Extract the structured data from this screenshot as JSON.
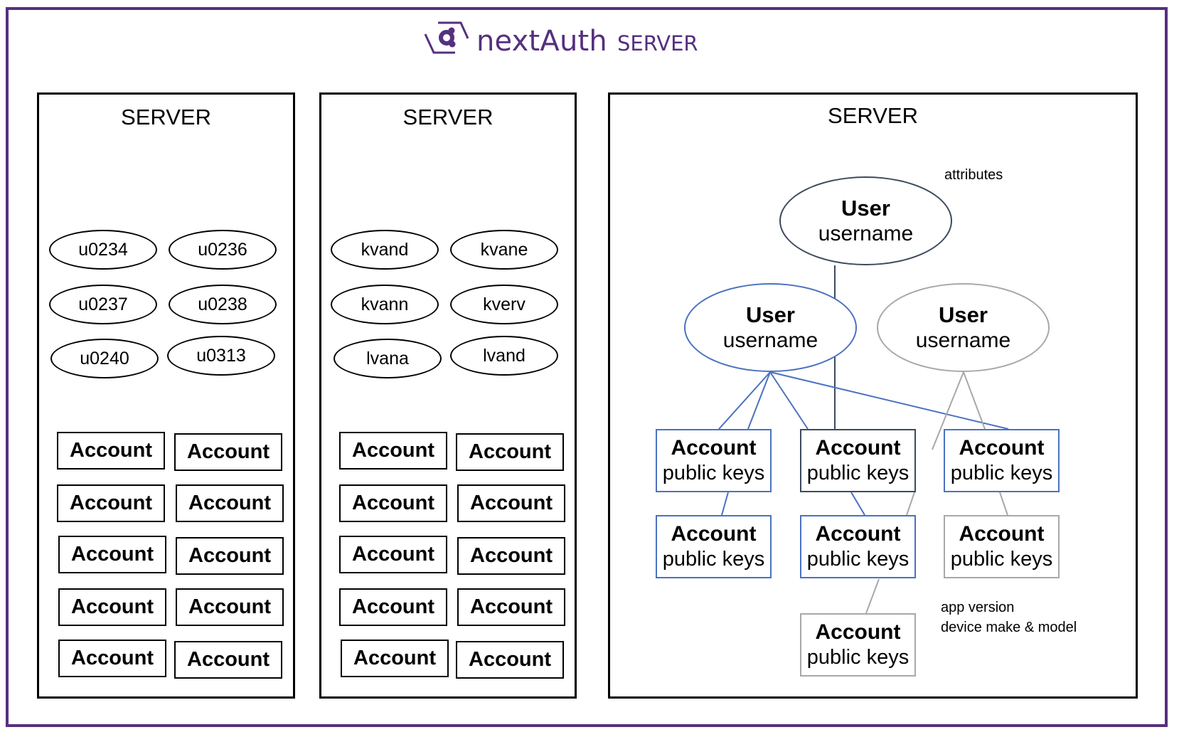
{
  "brand": {
    "name": "nextAuth",
    "suffix": "SERVER",
    "logo_icon": "nextauth-logo-icon",
    "color": "#55307f"
  },
  "colors": {
    "frame": "#55307f",
    "blue": "#4a72c0",
    "slate": "#3d4a5e",
    "gray": "#a8a8a8"
  },
  "panels": [
    {
      "title": "SERVER",
      "ovals": [
        "u0234",
        "u0236",
        "u0237",
        "u0238",
        "u0240",
        "u0313"
      ],
      "accounts": [
        "Account",
        "Account",
        "Account",
        "Account",
        "Account",
        "Account",
        "Account",
        "Account",
        "Account",
        "Account"
      ]
    },
    {
      "title": "SERVER",
      "ovals": [
        "kvand",
        "kvane",
        "kvann",
        "kverv",
        "lvana",
        "lvand"
      ],
      "accounts": [
        "Account",
        "Account",
        "Account",
        "Account",
        "Account",
        "Account",
        "Account",
        "Account",
        "Account",
        "Account"
      ]
    },
    {
      "title": "SERVER",
      "users": [
        {
          "title": "User",
          "subtitle": "username",
          "style": "slate"
        },
        {
          "title": "User",
          "subtitle": "username",
          "style": "blue"
        },
        {
          "title": "User",
          "subtitle": "username",
          "style": "gray"
        }
      ],
      "accounts": [
        {
          "title": "Account",
          "subtitle": "public keys",
          "style": "blue"
        },
        {
          "title": "Account",
          "subtitle": "public keys",
          "style": "slate"
        },
        {
          "title": "Account",
          "subtitle": "public keys",
          "style": "blue"
        },
        {
          "title": "Account",
          "subtitle": "public keys",
          "style": "blue"
        },
        {
          "title": "Account",
          "subtitle": "public keys",
          "style": "blue"
        },
        {
          "title": "Account",
          "subtitle": "public keys",
          "style": "gray"
        },
        {
          "title": "Account",
          "subtitle": "public keys",
          "style": "gray"
        }
      ],
      "notes": {
        "user_note": "attributes",
        "account_note_line1": "app version",
        "account_note_line2": "device make & model"
      }
    }
  ]
}
